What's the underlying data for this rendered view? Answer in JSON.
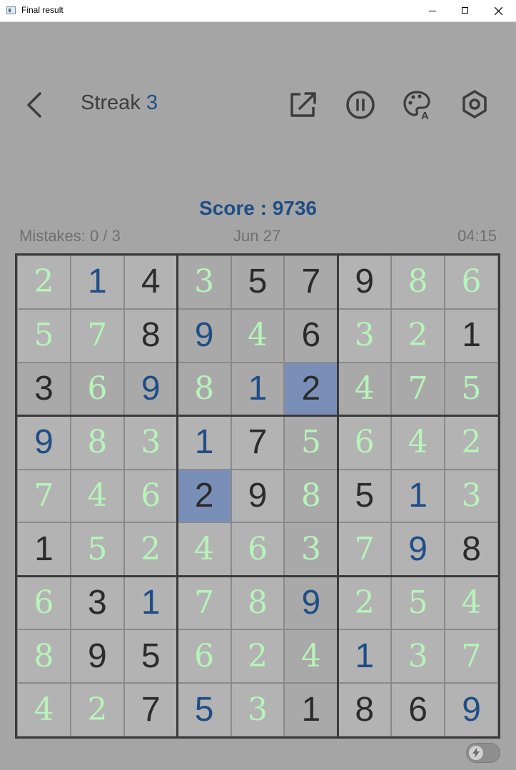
{
  "window": {
    "title": "Final result"
  },
  "header": {
    "streak_label": "Streak",
    "streak_value": "3"
  },
  "toolbar": [
    "share-icon",
    "pause-icon",
    "theme-palette-icon",
    "settings-icon"
  ],
  "game": {
    "score": "Score : 9736",
    "mistakes": "Mistakes: 0 / 3",
    "date": "Jun 27",
    "time": "04:15"
  },
  "grid": {
    "values": [
      [
        "2",
        "1",
        "4",
        "3",
        "5",
        "7",
        "9",
        "8",
        "6"
      ],
      [
        "5",
        "7",
        "8",
        "9",
        "4",
        "6",
        "3",
        "2",
        "1"
      ],
      [
        "3",
        "6",
        "9",
        "8",
        "1",
        "2",
        "4",
        "7",
        "5"
      ],
      [
        "9",
        "8",
        "3",
        "1",
        "7",
        "5",
        "6",
        "4",
        "2"
      ],
      [
        "7",
        "4",
        "6",
        "2",
        "9",
        "8",
        "5",
        "1",
        "3"
      ],
      [
        "1",
        "5",
        "2",
        "4",
        "6",
        "3",
        "7",
        "9",
        "8"
      ],
      [
        "6",
        "3",
        "1",
        "7",
        "8",
        "9",
        "2",
        "5",
        "4"
      ],
      [
        "8",
        "9",
        "5",
        "6",
        "2",
        "4",
        "1",
        "3",
        "7"
      ],
      [
        "4",
        "2",
        "7",
        "5",
        "3",
        "1",
        "8",
        "6",
        "9"
      ]
    ],
    "kinds": [
      [
        "a",
        "u",
        "g",
        "a",
        "g",
        "g",
        "g",
        "a",
        "a"
      ],
      [
        "a",
        "a",
        "g",
        "u",
        "a",
        "g",
        "a",
        "a",
        "g"
      ],
      [
        "g",
        "a",
        "u",
        "a",
        "u",
        "g",
        "a",
        "a",
        "a"
      ],
      [
        "u",
        "a",
        "a",
        "u",
        "g",
        "a",
        "a",
        "a",
        "a"
      ],
      [
        "a",
        "a",
        "a",
        "g",
        "g",
        "a",
        "g",
        "u",
        "a"
      ],
      [
        "g",
        "a",
        "a",
        "a",
        "a",
        "a",
        "a",
        "u",
        "g"
      ],
      [
        "a",
        "g",
        "u",
        "a",
        "a",
        "u",
        "a",
        "a",
        "a"
      ],
      [
        "a",
        "g",
        "g",
        "a",
        "a",
        "a",
        "u",
        "a",
        "a"
      ],
      [
        "a",
        "a",
        "g",
        "u",
        "a",
        "g",
        "g",
        "g",
        "u"
      ]
    ],
    "colors": {
      "given": "#2b2b2b",
      "user": "#1f4e86",
      "auto": "#b7f4b9",
      "selected": "#7a8fb8"
    }
  },
  "footer": {
    "toggle_icon": "bolt-icon"
  }
}
